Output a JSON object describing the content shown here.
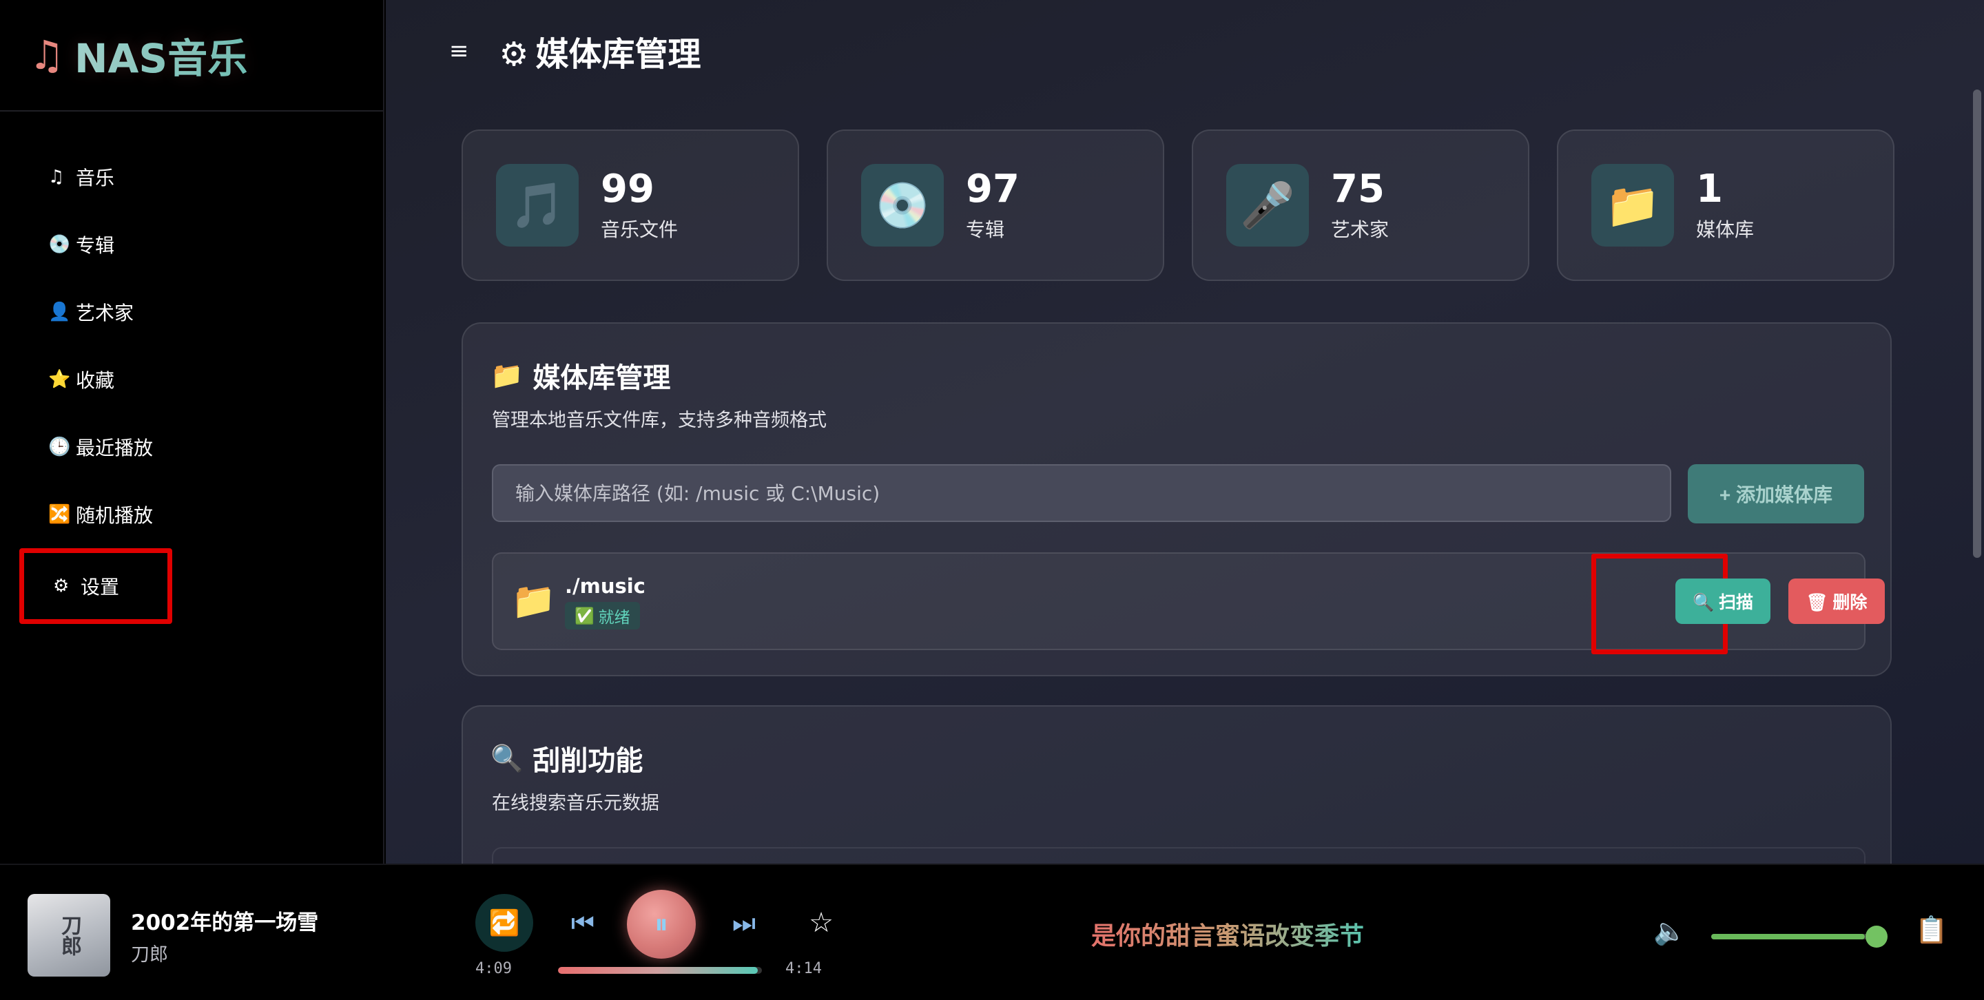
{
  "app": {
    "logo_icon": "♫",
    "logo_text": "NAS音乐"
  },
  "sidebar": {
    "items": [
      {
        "icon": "♫",
        "label": "音乐"
      },
      {
        "icon": "💿",
        "label": "专辑"
      },
      {
        "icon": "👤",
        "label": "艺术家"
      },
      {
        "icon": "⭐",
        "label": "收藏"
      },
      {
        "icon": "🕒",
        "label": "最近播放"
      },
      {
        "icon": "🔀",
        "label": "随机播放"
      },
      {
        "icon": "⚙",
        "label": "设置"
      }
    ]
  },
  "header": {
    "menu_icon": "≡",
    "title_icon": "⚙",
    "title": "媒体库管理"
  },
  "stats": [
    {
      "icon": "🎵",
      "value": "99",
      "label": "音乐文件"
    },
    {
      "icon": "💿",
      "value": "97",
      "label": "专辑"
    },
    {
      "icon": "🎤",
      "value": "75",
      "label": "艺术家"
    },
    {
      "icon": "📁",
      "value": "1",
      "label": "媒体库"
    }
  ],
  "library_panel": {
    "icon": "📁",
    "title": "媒体库管理",
    "description": "管理本地音乐文件库，支持多种音频格式",
    "input_placeholder": "输入媒体库路径 (如: /music 或 C:\\Music)",
    "add_button": "+ 添加媒体库",
    "libraries": [
      {
        "icon": "📁",
        "path": "./music",
        "status_icon": "✅",
        "status": "就绪",
        "scan_label": "🔍 扫描",
        "delete_label": "🗑 删除"
      }
    ]
  },
  "scrape_panel": {
    "icon": "🔍",
    "title": "刮削功能",
    "description": "在线搜索音乐元数据"
  },
  "player": {
    "cover_text": "刀郎",
    "song_title": "2002年的第一场雪",
    "artist": "刀郎",
    "repeat_icon": "🔁",
    "prev_icon": "⏮",
    "play_icon": "⏸",
    "next_icon": "⏭",
    "favorite_icon": "☆",
    "current_time": "4:09",
    "total_time": "4:14",
    "progress": 0.98,
    "lyric": "是你的甜言蜜语改变季节",
    "volume_icon": "🔈",
    "volume": 0.93,
    "playlist_icon": "📋"
  },
  "colors": {
    "accent": "#3db09a",
    "danger": "#e35b5e",
    "highlight": "#e00000"
  }
}
